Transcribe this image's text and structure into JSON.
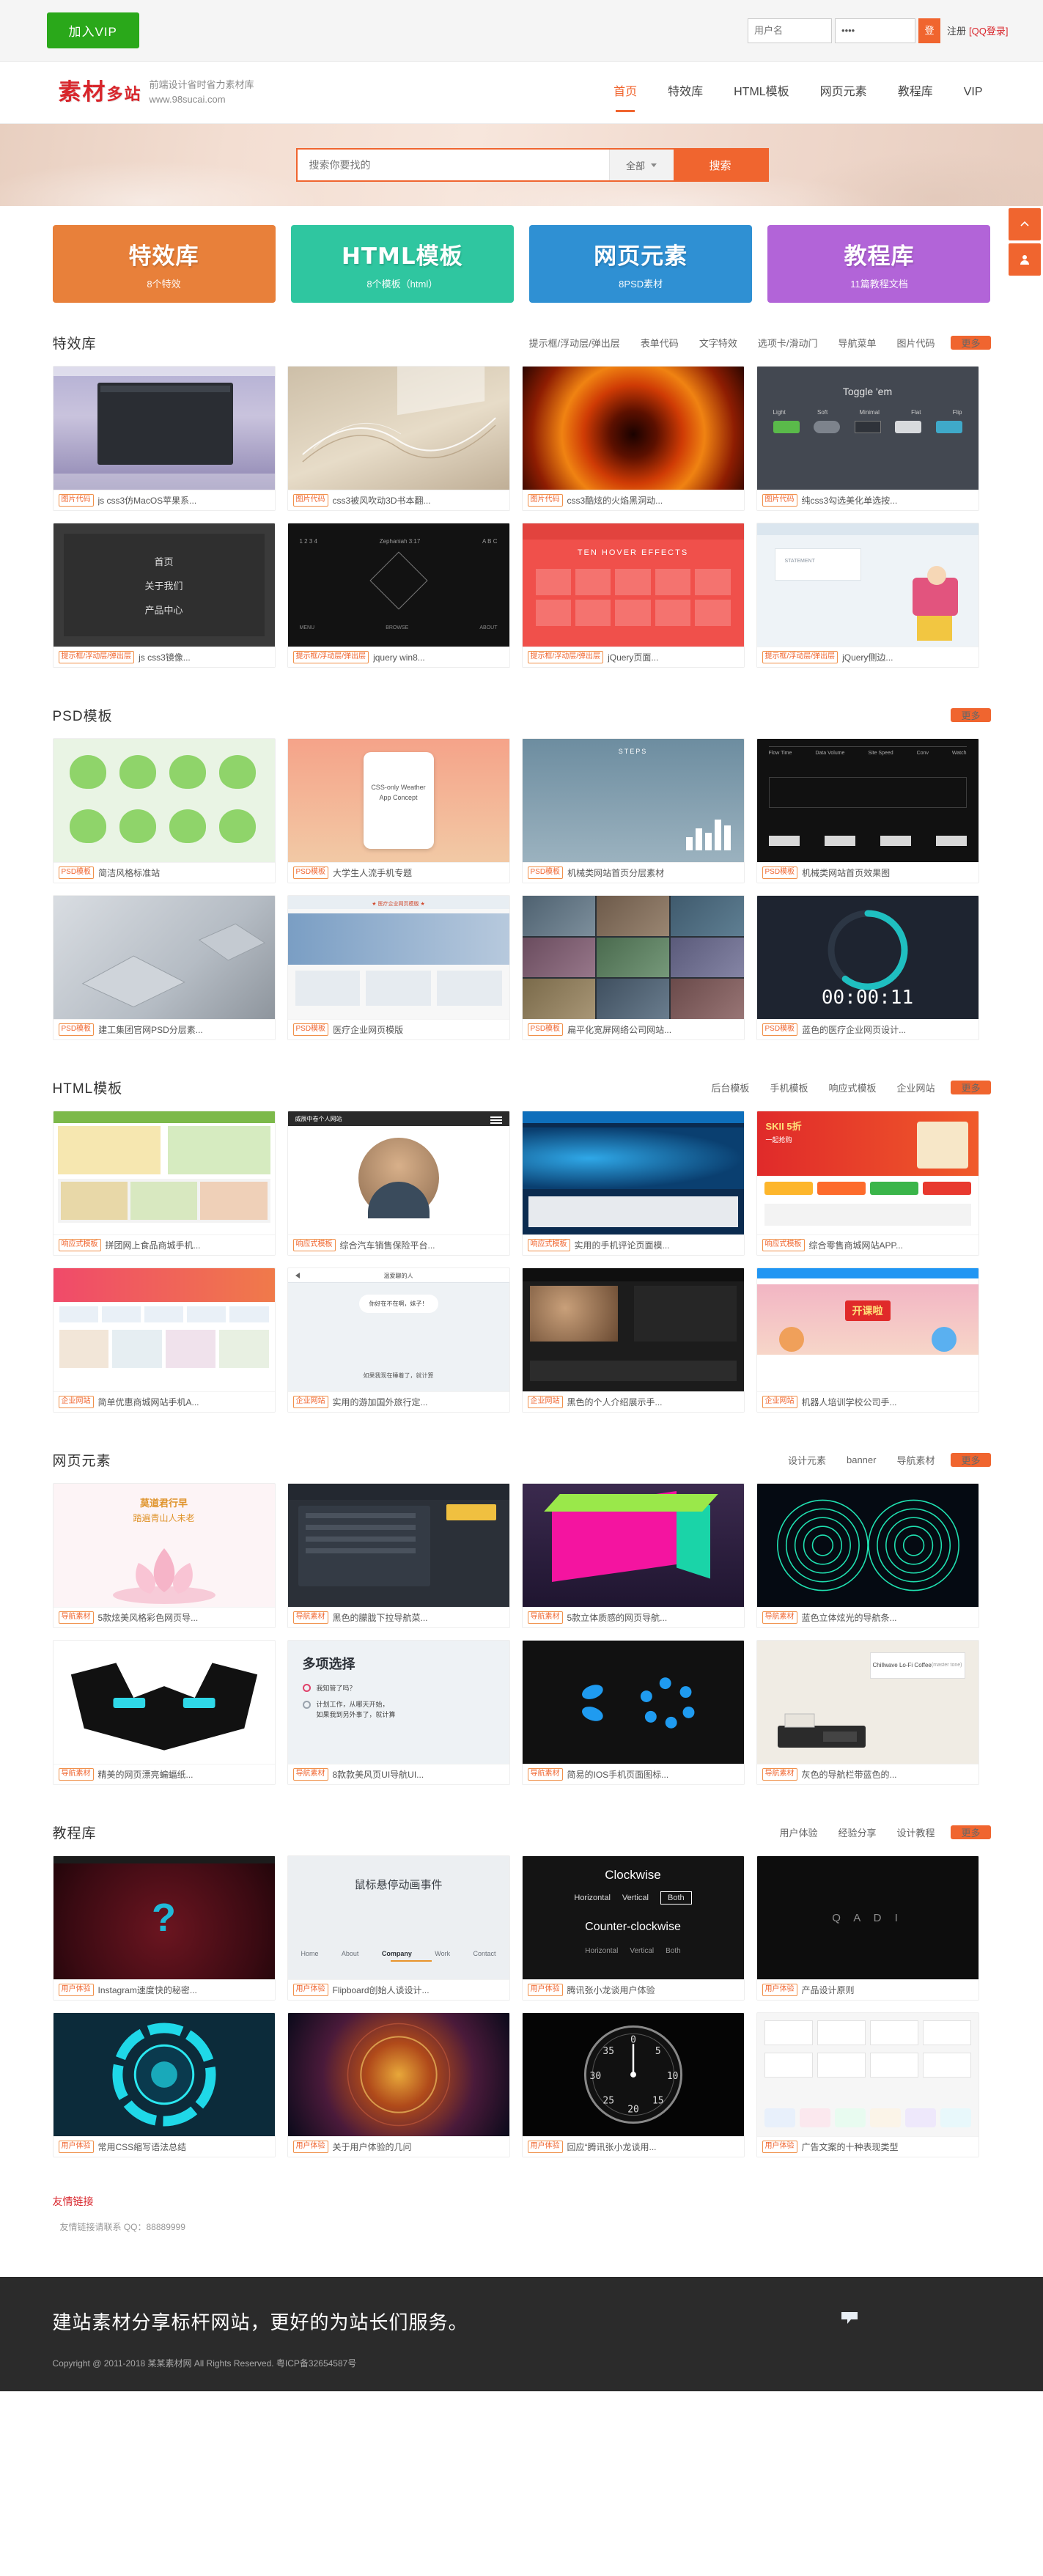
{
  "topbar": {
    "vip_button": "加入VIP",
    "username_placeholder": "用户名",
    "password_value": "••••",
    "login_button": "登",
    "register_link": "注册",
    "qq_login_link": "[QQ登录]"
  },
  "header": {
    "logo_chars": [
      "素",
      "材",
      "多",
      "站"
    ],
    "logo_tagline": "前端设计省时省力素材库",
    "logo_url": "www.98sucai.com",
    "nav": [
      {
        "label": "首页",
        "active": true
      },
      {
        "label": "特效库",
        "active": false
      },
      {
        "label": "HTML模板",
        "active": false
      },
      {
        "label": "网页元素",
        "active": false
      },
      {
        "label": "教程库",
        "active": false
      },
      {
        "label": "VIP",
        "active": false
      }
    ]
  },
  "search": {
    "placeholder": "搜索你要找的",
    "scope": "全部",
    "button": "搜索"
  },
  "category_cards": [
    {
      "title": "特效库",
      "sub": "8个特效",
      "color": "#e8803a"
    },
    {
      "title": "HTML模板",
      "sub": "8个模板（html）",
      "color": "#2fc6a0"
    },
    {
      "title": "网页元素",
      "sub": "8PSD素材",
      "color": "#2f90d3"
    },
    {
      "title": "教程库",
      "sub": "11篇教程文档",
      "color": "#b264d8"
    }
  ],
  "float_bar": {
    "top_icon": "arrow-up-icon",
    "user_icon": "user-icon"
  },
  "sections": [
    {
      "id": "effects",
      "title": "特效库",
      "links": [
        "提示框/浮动层/弹出层",
        "表单代码",
        "文字特效",
        "选项卡/滑动门",
        "导航菜单",
        "图片代码"
      ],
      "more": "更多",
      "rows": [
        [
          {
            "tag": "图片代码",
            "caption": "js css3仿MacOS苹果系...",
            "art": "macos"
          },
          {
            "tag": "图片代码",
            "caption": "css3被风吹动3D书本翻...",
            "art": "book"
          },
          {
            "tag": "图片代码",
            "caption": "css3酷炫的火焰黑洞动...",
            "art": "fire"
          },
          {
            "tag": "图片代码",
            "caption": "纯css3勾选美化单选按...",
            "art": "toggle"
          }
        ],
        [
          {
            "tag": "提示框/浮动层/弹出层",
            "caption": "js css3镜像...",
            "art": "menu"
          },
          {
            "tag": "提示框/浮动层/弹出层",
            "caption": "jquery win8...",
            "art": "dark"
          },
          {
            "tag": "提示框/浮动层/弹出层",
            "caption": "jQuery页面...",
            "art": "hover"
          },
          {
            "tag": "提示框/浮动层/弹出层",
            "caption": "jQuery侧边...",
            "art": "flat"
          }
        ]
      ]
    },
    {
      "id": "psd",
      "title": "PSD模板",
      "links": [],
      "more": "更多",
      "rows": [
        [
          {
            "tag": "PSD模板",
            "caption": "简洁风格标准站",
            "art": "frogs"
          },
          {
            "tag": "PSD模板",
            "caption": "大学生人流手机专题",
            "art": "weather"
          },
          {
            "tag": "PSD模板",
            "caption": "机械类网站首页分层素材",
            "art": "steps"
          },
          {
            "tag": "PSD模板",
            "caption": "机械类网站首页效果图",
            "art": "blackui"
          }
        ],
        [
          {
            "tag": "PSD模板",
            "caption": "建工集团官网PSD分层素...",
            "art": "gray3d"
          },
          {
            "tag": "PSD模板",
            "caption": "医疗企业网页模版",
            "art": "medical"
          },
          {
            "tag": "PSD模板",
            "caption": "扁平化宽屏网络公司网站...",
            "art": "collage"
          },
          {
            "tag": "PSD模板",
            "caption": "蓝色的医疗企业网页设计...",
            "art": "timer"
          }
        ]
      ]
    },
    {
      "id": "html",
      "title": "HTML模板",
      "links": [
        "后台模板",
        "手机模板",
        "响应式模板",
        "企业网站"
      ],
      "more": "更多",
      "rows": [
        [
          {
            "tag": "响应式模板",
            "caption": "拼团网上食品商城手机...",
            "art": "food"
          },
          {
            "tag": "响应式模板",
            "caption": "综合汽车销售保险平台...",
            "art": "portrait"
          },
          {
            "tag": "响应式模板",
            "caption": "实用的手机评论页面模...",
            "art": "bluetech"
          },
          {
            "tag": "响应式模板",
            "caption": "综合零售商城网站APP...",
            "art": "shop"
          }
        ],
        [
          {
            "tag": "企业网站",
            "caption": "简单优惠商城网站手机A...",
            "art": "mall"
          },
          {
            "tag": "企业网站",
            "caption": "实用的游加国外旅行定...",
            "art": "chat"
          },
          {
            "tag": "企业网站",
            "caption": "黑色的个人介绍展示手...",
            "art": "darkprofile"
          },
          {
            "tag": "企业网站",
            "caption": "机器人培训学校公司手...",
            "art": "promo"
          }
        ]
      ]
    },
    {
      "id": "elements",
      "title": "网页元素",
      "links": [
        "设计元素",
        "banner",
        "导航素材"
      ],
      "more": "更多",
      "rows": [
        [
          {
            "tag": "导航素材",
            "caption": "5款炫美风格彩色网页导...",
            "art": "lotus"
          },
          {
            "tag": "导航素材",
            "caption": "黑色的朦胧下拉导航菜...",
            "art": "darknav"
          },
          {
            "tag": "导航素材",
            "caption": "5款立体质感的网页导航...",
            "art": "cube"
          },
          {
            "tag": "导航素材",
            "caption": "蓝色立体炫光的导航条...",
            "art": "spiral"
          }
        ],
        [
          {
            "tag": "导航素材",
            "caption": "精美的网页漂亮蝙蝠纸...",
            "art": "bat"
          },
          {
            "tag": "导航素材",
            "caption": "8款款美风页UI导航UI...",
            "art": "radio"
          },
          {
            "tag": "导航素材",
            "caption": "简易的IOS手机页面图标...",
            "art": "loader"
          },
          {
            "tag": "导航素材",
            "caption": "灰色的导航栏带蓝色的...",
            "art": "coffee"
          }
        ]
      ]
    },
    {
      "id": "tutorial",
      "title": "教程库",
      "links": [
        "用户体验",
        "经验分享",
        "设计教程"
      ],
      "more": "更多",
      "rows": [
        [
          {
            "tag": "用户体验",
            "caption": "Instagram速度快的秘密...",
            "art": "question"
          },
          {
            "tag": "用户体验",
            "caption": "Flipboard创始人谈设计...",
            "art": "hoverdoc"
          },
          {
            "tag": "用户体验",
            "caption": "腾讯张小龙谈用户体验",
            "art": "clockwise"
          },
          {
            "tag": "用户体验",
            "caption": "产品设计原则",
            "art": "qadi"
          }
        ],
        [
          {
            "tag": "用户体验",
            "caption": "常用CSS缩写语法总结",
            "art": "cyan"
          },
          {
            "tag": "用户体验",
            "caption": "关于用户体验的几问",
            "art": "cosmic"
          },
          {
            "tag": "用户体验",
            "caption": "回应“腾讯张小龙谈用...",
            "art": "gauge"
          },
          {
            "tag": "用户体验",
            "caption": "广告文案的十种表现类型",
            "art": "icons"
          }
        ]
      ]
    }
  ],
  "friend_links": {
    "title": "友情链接",
    "note": "友情链接请联系 QQ：88889999"
  },
  "footer": {
    "slogan": "建站素材分享标杆网站，更好的为站长们服务。",
    "copyright": "Copyright @ 2011-2018 某某素材网 All Rights Reserved. 粤ICP备32654587号",
    "badge_icon": "flag-icon"
  }
}
